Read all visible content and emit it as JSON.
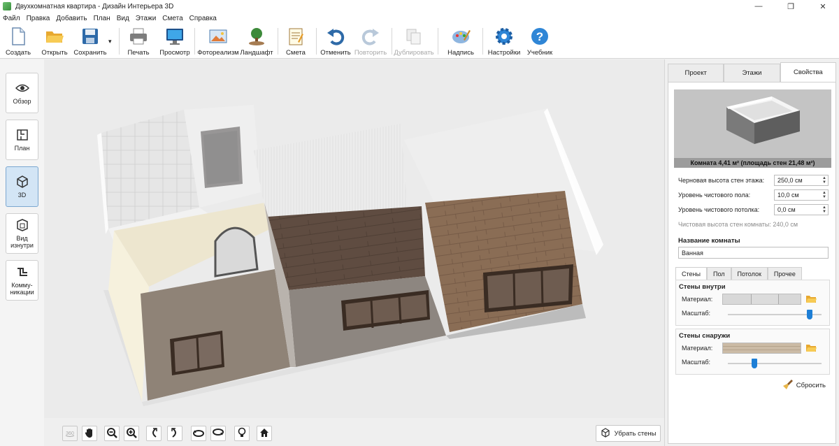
{
  "window": {
    "title": "Двухкомнатная квартира - Дизайн Интерьера 3D",
    "controls": [
      "—",
      "❐",
      "✕"
    ]
  },
  "menu": [
    "Файл",
    "Правка",
    "Добавить",
    "План",
    "Вид",
    "Этажи",
    "Смета",
    "Справка"
  ],
  "toolbar": [
    {
      "id": "create",
      "label": "Создать",
      "icon": "new-document-icon"
    },
    {
      "id": "open",
      "label": "Открыть",
      "icon": "folder-open-icon"
    },
    {
      "id": "save",
      "label": "Сохранить",
      "icon": "floppy-disk-icon",
      "dropdown": "▾"
    },
    {
      "id": "print",
      "label": "Печать",
      "icon": "printer-icon"
    },
    {
      "id": "preview",
      "label": "Просмотр",
      "icon": "monitor-icon"
    },
    {
      "id": "photorealism",
      "label": "Фотореализм",
      "icon": "picture-icon"
    },
    {
      "id": "landscape",
      "label": "Ландшафт",
      "icon": "tree-icon"
    },
    {
      "id": "estimate",
      "label": "Смета",
      "icon": "notepad-icon"
    },
    {
      "id": "undo",
      "label": "Отменить",
      "icon": "undo-arrow-icon"
    },
    {
      "id": "redo",
      "label": "Повторить",
      "icon": "redo-arrow-icon",
      "disabled": true
    },
    {
      "id": "duplicate",
      "label": "Дублировать",
      "icon": "duplicate-icon",
      "disabled": true
    },
    {
      "id": "caption",
      "label": "Надпись",
      "icon": "palette-icon"
    },
    {
      "id": "settings",
      "label": "Настройки",
      "icon": "gear-icon"
    },
    {
      "id": "tutorial",
      "label": "Учебник",
      "icon": "help-icon"
    }
  ],
  "left_views": [
    {
      "id": "overview",
      "label": "Обзор",
      "icon": "eye-icon"
    },
    {
      "id": "plan",
      "label": "План",
      "icon": "plan-icon"
    },
    {
      "id": "3d",
      "label": "3D",
      "icon": "cube-icon",
      "active": true
    },
    {
      "id": "inside",
      "label": "Вид\nизнутри",
      "icon": "room-inside-icon"
    },
    {
      "id": "utilities",
      "label": "Комму-\nникации",
      "icon": "pipes-icon"
    }
  ],
  "bottom_tools": [
    {
      "id": "rotate360",
      "icon": "rotate-360-icon",
      "disabled": true
    },
    {
      "id": "pan",
      "icon": "hand-icon"
    },
    {
      "id": "zoom_out",
      "icon": "zoom-out-icon"
    },
    {
      "id": "zoom_in",
      "icon": "zoom-in-icon"
    },
    {
      "id": "rotate_left",
      "icon": "rotate-left-icon"
    },
    {
      "id": "rotate_right",
      "icon": "rotate-right-icon"
    },
    {
      "id": "tilt_up",
      "icon": "tilt-up-icon"
    },
    {
      "id": "tilt_down",
      "icon": "tilt-down-icon"
    },
    {
      "id": "light",
      "icon": "light-bulb-icon"
    },
    {
      "id": "home",
      "icon": "home-icon"
    }
  ],
  "remove_walls_label": "Убрать стены",
  "panel": {
    "tabs": [
      {
        "label": "Проект"
      },
      {
        "label": "Этажи"
      },
      {
        "label": "Свойства",
        "active": true
      }
    ],
    "preview_caption": "Комната 4,41 м²  (площадь стен 21,48 м²)",
    "props": [
      {
        "label": "Черновая высота стен этажа:",
        "value": "250,0 см"
      },
      {
        "label": "Уровень чистового пола:",
        "value": "10,0 см"
      },
      {
        "label": "Уровень чистового потолка:",
        "value": "0,0 см"
      }
    ],
    "clean_height_note": "Чистовая высота стен комнаты: 240,0 см",
    "room_name_title": "Название комнаты",
    "room_name_value": "Ванная",
    "subtabs": [
      {
        "label": "Стены",
        "active": true
      },
      {
        "label": "Пол"
      },
      {
        "label": "Потолок"
      },
      {
        "label": "Прочее"
      }
    ],
    "walls_inside": {
      "title": "Стены внутри",
      "material_label": "Материал:",
      "scale_label": "Масштаб:",
      "scale_level": 0.9
    },
    "walls_outside": {
      "title": "Стены снаружи",
      "material_label": "Материал:",
      "scale_label": "Масштаб:",
      "scale_level": 0.27
    },
    "reset_label": "Сбросить"
  },
  "colors": {
    "active_blue": "#1e7fd6",
    "active_view_bg": "#d3e5f5",
    "floor_dark": "#5f4c41",
    "floor_light": "#8a6d55",
    "wall_beige": "#ede6cf"
  }
}
